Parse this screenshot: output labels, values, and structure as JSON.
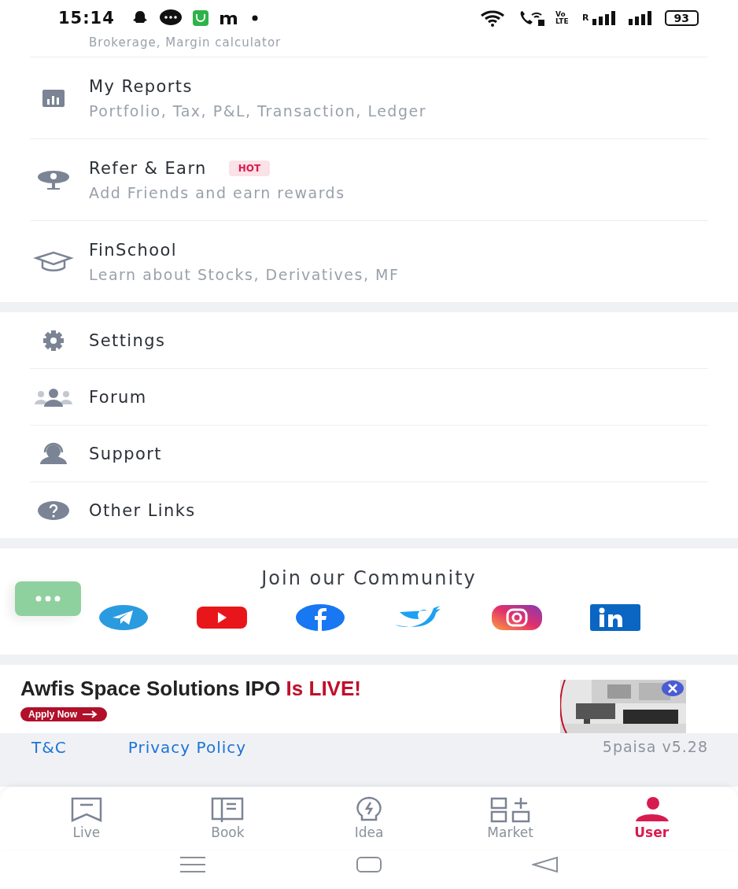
{
  "status_bar": {
    "time": "15:14",
    "volte": "Vo LTE",
    "roaming": "R",
    "battery": "93"
  },
  "partial_row": {
    "subtitle": "Brokerage, Margin calculator"
  },
  "menu_top": [
    {
      "title": "My Reports",
      "subtitle": "Portfolio, Tax, P&L, Transaction, Ledger"
    },
    {
      "title": "Refer & Earn",
      "badge": "HOT",
      "subtitle": "Add Friends and earn rewards"
    },
    {
      "title": "FinSchool",
      "subtitle": "Learn about Stocks, Derivatives, MF"
    }
  ],
  "menu_bottom": [
    {
      "title": "Settings"
    },
    {
      "title": "Forum"
    },
    {
      "title": "Support"
    },
    {
      "title": "Other Links"
    }
  ],
  "community": {
    "title": "Join our Community"
  },
  "banner": {
    "headline": "Awfis Space Solutions IPO",
    "highlight": "Is LIVE!",
    "button": "Apply Now"
  },
  "footer": {
    "links": [
      "T&C",
      "Privacy Policy"
    ],
    "version": "5paisa v5.28"
  },
  "bottom_nav": [
    {
      "label": "Live",
      "selected": false
    },
    {
      "label": "Book",
      "selected": false
    },
    {
      "label": "Idea",
      "selected": false
    },
    {
      "label": "Market",
      "selected": false
    },
    {
      "label": "User",
      "selected": true
    }
  ]
}
